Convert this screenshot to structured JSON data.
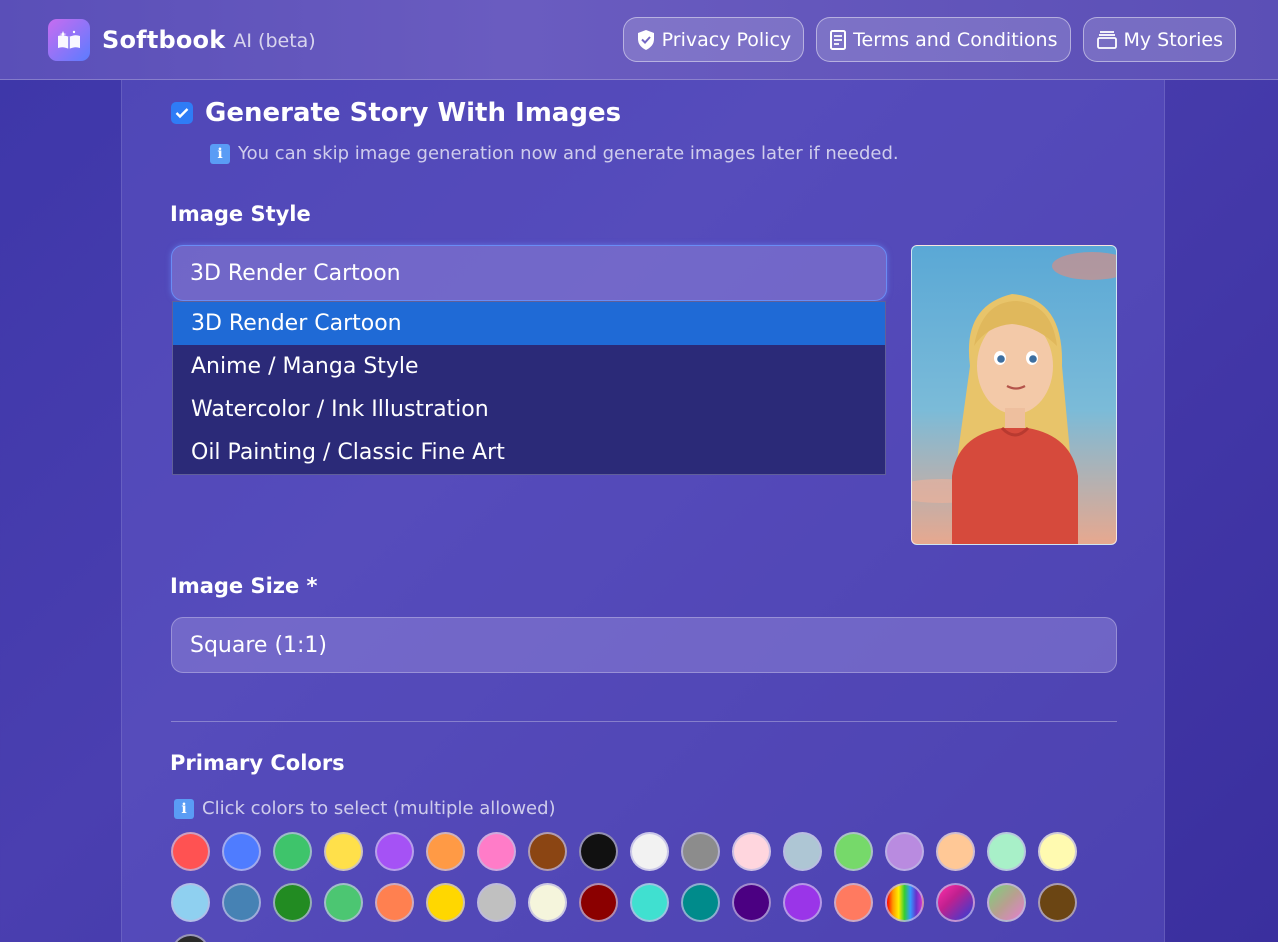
{
  "header": {
    "brand": "Softbook",
    "brand_sub": "AI (beta)",
    "nav": [
      {
        "label": "Privacy Policy",
        "icon": "shield-icon"
      },
      {
        "label": "Terms and Conditions",
        "icon": "document-icon"
      },
      {
        "label": "My Stories",
        "icon": "stack-icon"
      }
    ]
  },
  "form": {
    "generate_images": {
      "label": "Generate Story With Images",
      "checked": true
    },
    "skip_note": "You can skip image generation now and generate images later if needed.",
    "image_style": {
      "label": "Image Style",
      "selected": "3D Render Cartoon",
      "options": [
        "3D Render Cartoon",
        "Anime / Manga Style",
        "Watercolor / Ink Illustration",
        "Oil Painting / Classic Fine Art"
      ]
    },
    "image_size": {
      "label": "Image Size *",
      "selected": "Square (1:1)"
    },
    "primary_colors": {
      "label": "Primary Colors",
      "hint": "Click colors to select (multiple allowed)",
      "row1": [
        "#ff5252",
        "#4f7cff",
        "#3ec46b",
        "#ffe04a",
        "#a552f5",
        "#ff9a45",
        "#ff7cc8",
        "#8b4513",
        "#111111",
        "#f2f2f2",
        "#8c8c8c",
        "#ffd6de",
        "#aec6d4",
        "#76d96a",
        "#b98be0",
        "#ffc896",
        "#a8f0c8",
        "#fffab0"
      ],
      "row2": [
        "#8fd0f0",
        "#4682b4",
        "#228b22",
        "#4cc672",
        "#ff8050",
        "#ffd700",
        "#c0c0c0",
        "#f5f5dc",
        "#8b0000",
        "#40e0d0",
        "#008b8b",
        "#4b0082",
        "#9a35e8",
        "#ff7a60",
        "rainbow",
        "magenta-blue",
        "green-pink",
        "#6b4513"
      ]
    }
  }
}
